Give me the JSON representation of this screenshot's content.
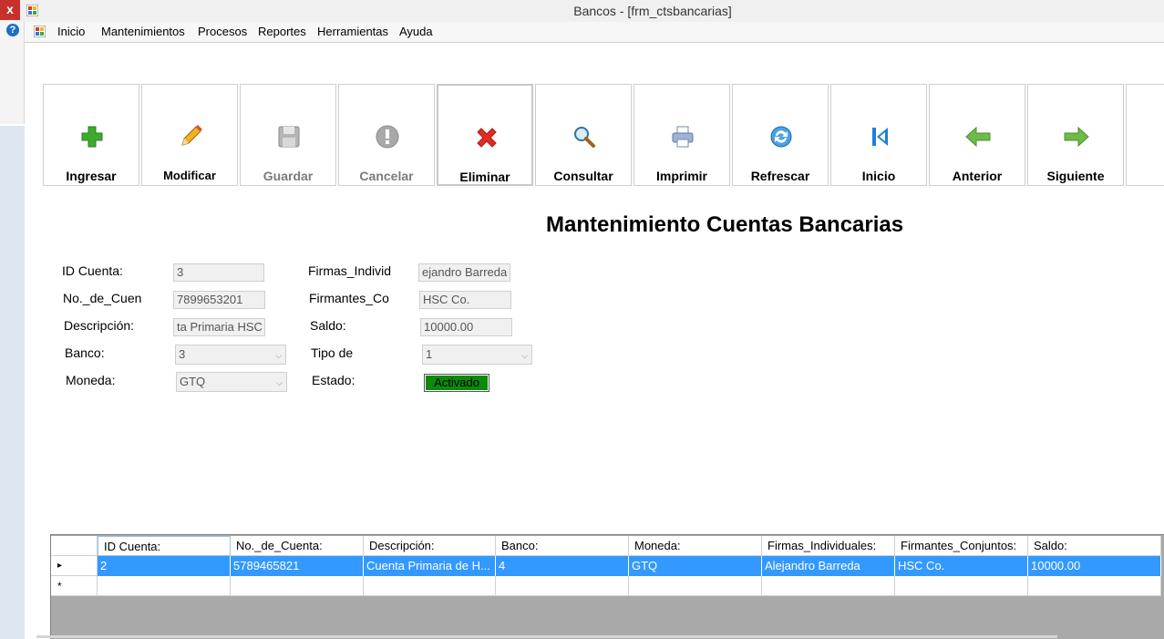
{
  "window": {
    "title": "Bancos - [frm_ctsbancarias]",
    "close_glyph": "x"
  },
  "menu": {
    "items": [
      "Inicio",
      "Mantenimientos",
      "Procesos",
      "Reportes",
      "Herramientas",
      "Ayuda"
    ]
  },
  "toolbar": {
    "buttons": [
      {
        "label": "Ingresar",
        "icon": "plus-icon"
      },
      {
        "label": "Modificar",
        "icon": "pencil-icon"
      },
      {
        "label": "Guardar",
        "icon": "floppy-icon"
      },
      {
        "label": "Cancelar",
        "icon": "exclamation-icon"
      },
      {
        "label": "Eliminar",
        "icon": "red-x-icon"
      },
      {
        "label": "Consultar",
        "icon": "magnifier-icon"
      },
      {
        "label": "Imprimir",
        "icon": "printer-icon"
      },
      {
        "label": "Refrescar",
        "icon": "refresh-icon"
      },
      {
        "label": "Inicio",
        "icon": "first-record-icon"
      },
      {
        "label": "Anterior",
        "icon": "arrow-left-icon"
      },
      {
        "label": "Siguiente",
        "icon": "arrow-right-icon"
      }
    ]
  },
  "form": {
    "heading": "Mantenimiento Cuentas Bancarias",
    "id_cuenta": {
      "label": "ID Cuenta:",
      "value": "3"
    },
    "no_cuenta": {
      "label": "No._de_Cuen",
      "value": "7899653201"
    },
    "descripcion": {
      "label": "Descripción:",
      "value": "ta Primaria HSC"
    },
    "banco": {
      "label": "Banco:",
      "value": "3"
    },
    "moneda": {
      "label": "Moneda:",
      "value": "GTQ"
    },
    "firmas": {
      "label": "Firmas_Individ",
      "value": "ejandro Barreda"
    },
    "firmantes": {
      "label": "Firmantes_Co",
      "value": "HSC Co."
    },
    "saldo": {
      "label": "Saldo:",
      "value": "10000.00"
    },
    "tipo": {
      "label": "Tipo de",
      "value": "1"
    },
    "estado": {
      "label": "Estado:",
      "value": "Activado",
      "color": "#0c8a0c"
    }
  },
  "grid": {
    "columns": [
      "ID Cuenta:",
      "No._de_Cuenta:",
      "Descripción:",
      "Banco:",
      "Moneda:",
      "Firmas_Individuales:",
      "Firmantes_Conjuntos:",
      "Saldo:"
    ],
    "rows": [
      [
        "2",
        "5789465821",
        "Cuenta Primaria de H...",
        "4",
        "GTQ",
        "Alejandro Barreda",
        "HSC Co.",
        "10000.00"
      ]
    ],
    "selected_row_marker": "▸",
    "new_row_marker": "*",
    "selection_color": "#3399ff"
  }
}
